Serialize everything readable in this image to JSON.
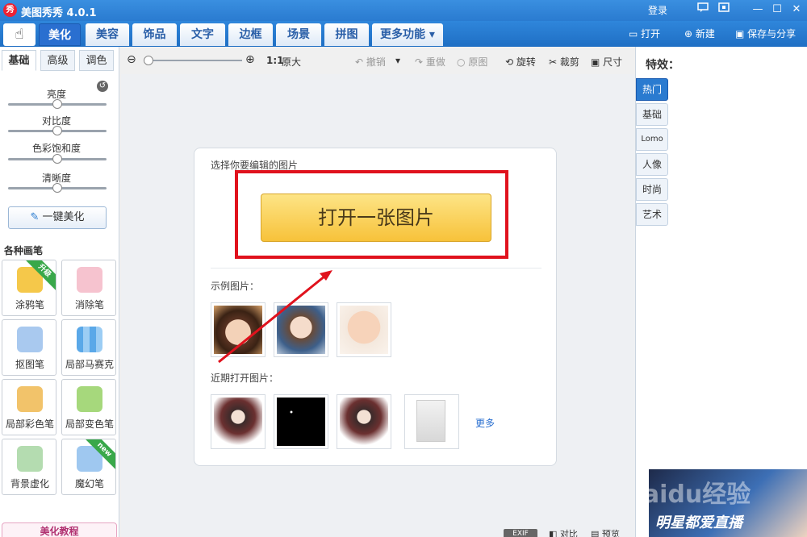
{
  "app": {
    "logo_text": "秀",
    "title": "美图秀秀 4.0.1",
    "login": "登录"
  },
  "window_buttons": {
    "minimize": "—",
    "maximize": "☐",
    "close": "✕"
  },
  "tabs": [
    {
      "label": "美化"
    },
    {
      "label": "美容"
    },
    {
      "label": "饰品"
    },
    {
      "label": "文字"
    },
    {
      "label": "边框"
    },
    {
      "label": "场景"
    },
    {
      "label": "拼图"
    },
    {
      "label": "更多功能 ▾"
    }
  ],
  "top_actions": {
    "open": "打开",
    "new": "新建",
    "save": "保存与分享"
  },
  "left_panel": {
    "subtabs": [
      {
        "label": "基础"
      },
      {
        "label": "高级"
      },
      {
        "label": "调色"
      }
    ],
    "sliders": [
      {
        "label": "亮度",
        "value": 0.5
      },
      {
        "label": "对比度",
        "value": 0.5
      },
      {
        "label": "色彩饱和度",
        "value": 0.5
      },
      {
        "label": "清晰度",
        "value": 0.5
      }
    ],
    "one_click": "一键美化",
    "brushes_title": "各种画笔",
    "brushes": [
      {
        "label": "涂鸦笔",
        "badge": "升级",
        "icon": "brush-icon",
        "color": "#f0a020"
      },
      {
        "label": "消除笔",
        "badge": "",
        "icon": "eraser-icon",
        "color": "#f29ab0"
      },
      {
        "label": "抠图笔",
        "badge": "",
        "icon": "pen-cutout-icon",
        "color": "#3a7fd5"
      },
      {
        "label": "局部马赛克",
        "badge": "",
        "icon": "mosaic-icon",
        "color": "#5aa8e8"
      },
      {
        "label": "局部彩色笔",
        "badge": "",
        "icon": "color-brush-icon",
        "color": "#e8a33a"
      },
      {
        "label": "局部变色笔",
        "badge": "",
        "icon": "paint-bucket-icon",
        "color": "#6dbb3c"
      },
      {
        "label": "背景虚化",
        "badge": "",
        "icon": "blur-icon",
        "color": "#6cbf6a"
      },
      {
        "label": "魔幻笔",
        "badge": "new",
        "icon": "magic-wand-icon",
        "color": "#3a8fe0"
      }
    ],
    "tutorial": "美化教程"
  },
  "toolbar": {
    "zoom_ratio": "1:1",
    "original_size": "原大",
    "zoom_level": 0.05,
    "undo": "撤销",
    "redo": "重做",
    "original": "原图",
    "rotate": "旋转",
    "crop": "裁剪",
    "size": "尺寸"
  },
  "card": {
    "title": "选择你要编辑的图片",
    "open_button": "打开一张图片",
    "sample_title": "示例图片：",
    "recent_title": "近期打开图片：",
    "more": "更多"
  },
  "bottom_bar": {
    "exif": "EXIF",
    "compare": "对比",
    "preview": "预览"
  },
  "right_panel": {
    "title": "特效：",
    "tabs": [
      {
        "label": "热门"
      },
      {
        "label": "基础"
      },
      {
        "label": "Lomo"
      },
      {
        "label": "人像"
      },
      {
        "label": "时尚"
      },
      {
        "label": "艺术"
      }
    ],
    "ad_text": "明星都爱直播",
    "watermark": "Baidu经验"
  },
  "colors": {
    "accent": "#2a7bd0",
    "highlight_box": "#e0121d",
    "open_button": "#f7c23a"
  }
}
